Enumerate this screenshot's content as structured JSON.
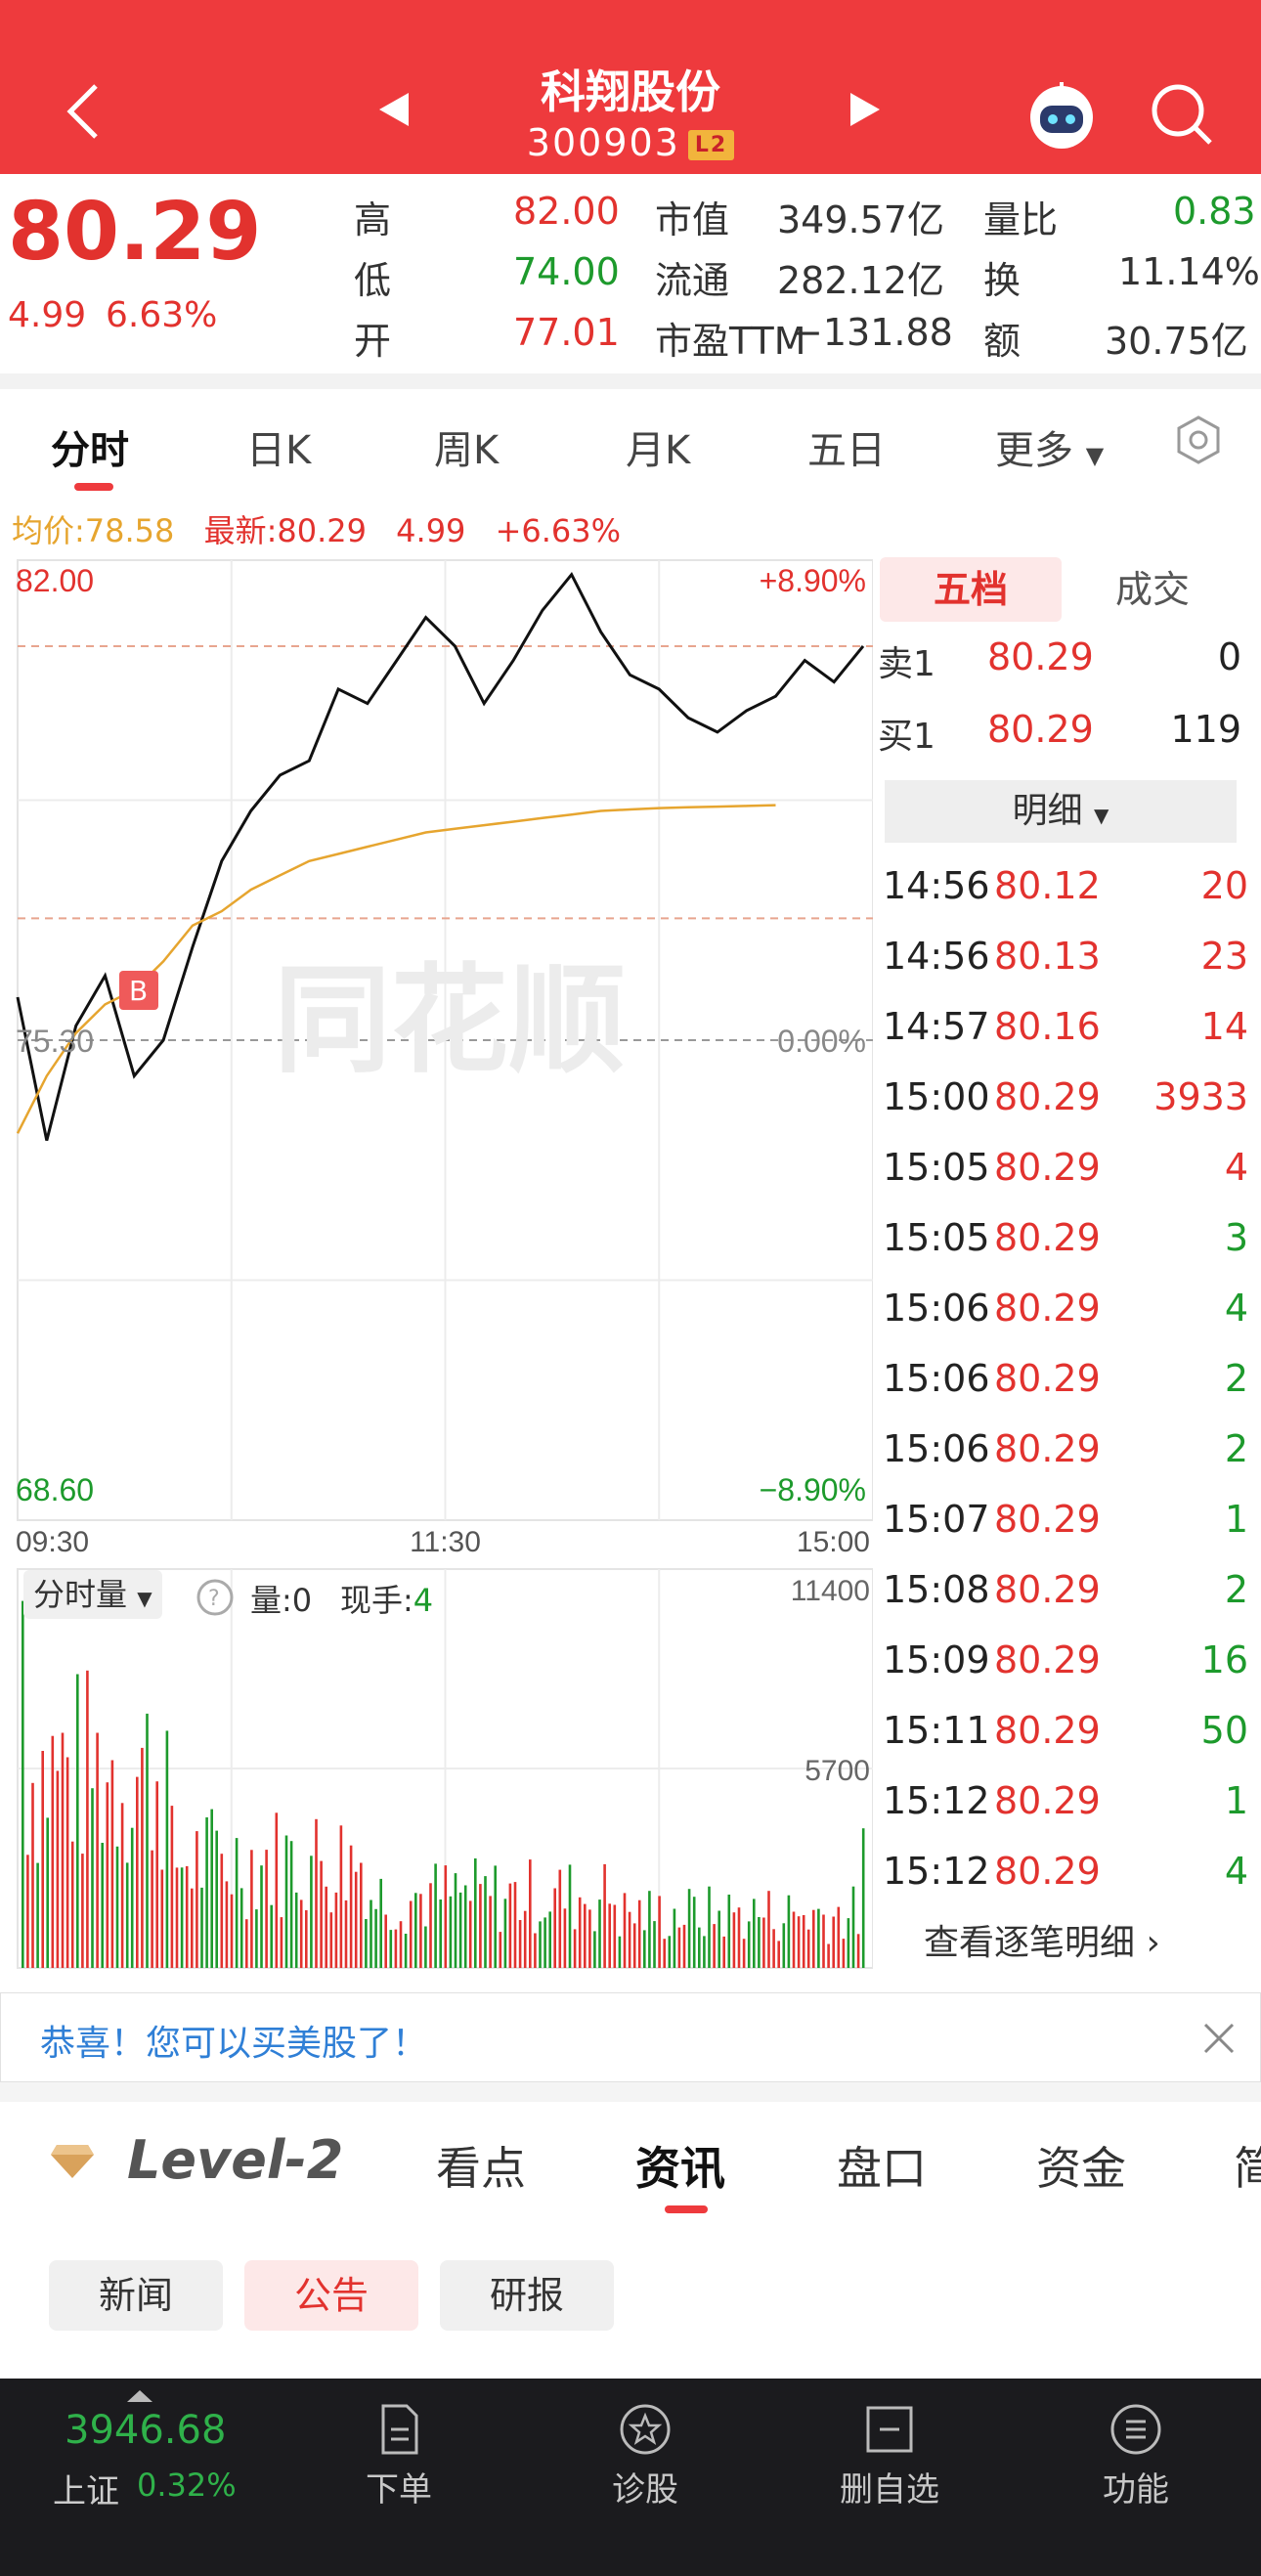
{
  "header": {
    "title": "科翔股份",
    "code": "300903",
    "badge": "L2"
  },
  "quote": {
    "price": "80.29",
    "change": "4.99",
    "change_pct": "6.63%",
    "high_label": "高",
    "high": "82.00",
    "low_label": "低",
    "low": "74.00",
    "open_label": "开",
    "open": "77.01",
    "mcap_label": "市值",
    "mcap": "349.57亿",
    "float_label": "流通",
    "float": "282.12亿",
    "pe_label": "市盈TTM",
    "pe": "−131.88",
    "vr_label": "量比",
    "vr": "0.83",
    "turn_label": "换",
    "turn": "11.14%",
    "amt_label": "额",
    "amt": "30.75亿"
  },
  "tabs": [
    "分时",
    "日K",
    "周K",
    "月K",
    "五日",
    "更多"
  ],
  "summary": {
    "avg": "均价:78.58",
    "latest": "最新:80.29",
    "chg": "4.99",
    "pct": "+6.63%"
  },
  "chart_data": {
    "type": "line",
    "title": "",
    "x_ticks": [
      "09:30",
      "11:30",
      "15:00"
    ],
    "y_left": [
      "82.00",
      "75.30",
      "68.60"
    ],
    "y_right": [
      "+8.90%",
      "0.00%",
      "−8.90%"
    ],
    "ylim": [
      68.6,
      82.0
    ],
    "prev_close": 75.3,
    "series": [
      {
        "name": "",
        "color": "#111111",
        "values": [
          75.9,
          73.9,
          75.5,
          76.2,
          74.8,
          75.3,
          76.6,
          77.8,
          78.5,
          79.0,
          79.2,
          80.2,
          80.0,
          80.6,
          81.2,
          80.8,
          80.0,
          80.6,
          81.3,
          81.8,
          81.0,
          80.4,
          80.2,
          79.8,
          79.6,
          79.9,
          80.1,
          80.6,
          80.3,
          80.8
        ]
      },
      {
        "name": "",
        "color": "#e6a52f",
        "values": [
          74.0,
          74.8,
          75.4,
          75.8,
          76.0,
          76.4,
          76.9,
          77.1,
          77.4,
          77.6,
          77.8,
          77.9,
          78.0,
          78.1,
          78.2,
          78.25,
          78.3,
          78.35,
          78.4,
          78.45,
          78.5,
          78.52,
          78.54,
          78.55,
          78.56,
          78.57,
          78.58
        ]
      }
    ],
    "marker": "B",
    "watermark": "同花顺"
  },
  "volume": {
    "label": "分时量",
    "q_label": "量:0",
    "hand_label": "现手:",
    "hand": "4",
    "max": "11400",
    "mid": "5700"
  },
  "orderbook": {
    "tabs": [
      "五档",
      "成交"
    ],
    "ask": {
      "label": "卖1",
      "price": "80.29",
      "vol": "0"
    },
    "bid": {
      "label": "买1",
      "price": "80.29",
      "vol": "119"
    },
    "detail_label": "明细",
    "ticks": [
      {
        "t": "14:56",
        "p": "80.12",
        "v": "20",
        "c": "red"
      },
      {
        "t": "14:56",
        "p": "80.13",
        "v": "23",
        "c": "red"
      },
      {
        "t": "14:57",
        "p": "80.16",
        "v": "14",
        "c": "red"
      },
      {
        "t": "15:00",
        "p": "80.29",
        "v": "3933",
        "c": "red"
      },
      {
        "t": "15:05",
        "p": "80.29",
        "v": "4",
        "c": "red"
      },
      {
        "t": "15:05",
        "p": "80.29",
        "v": "3",
        "c": "green"
      },
      {
        "t": "15:06",
        "p": "80.29",
        "v": "4",
        "c": "green"
      },
      {
        "t": "15:06",
        "p": "80.29",
        "v": "2",
        "c": "green"
      },
      {
        "t": "15:06",
        "p": "80.29",
        "v": "2",
        "c": "green"
      },
      {
        "t": "15:07",
        "p": "80.29",
        "v": "1",
        "c": "green"
      },
      {
        "t": "15:08",
        "p": "80.29",
        "v": "2",
        "c": "green"
      },
      {
        "t": "15:09",
        "p": "80.29",
        "v": "16",
        "c": "green"
      },
      {
        "t": "15:11",
        "p": "80.29",
        "v": "50",
        "c": "green"
      },
      {
        "t": "15:12",
        "p": "80.29",
        "v": "1",
        "c": "green"
      },
      {
        "t": "15:12",
        "p": "80.29",
        "v": "4",
        "c": "green"
      }
    ],
    "more": "查看逐笔明细 ›"
  },
  "banner": {
    "text": "恭喜！您可以买美股了！"
  },
  "news_tabs": {
    "level": "Level-2",
    "items": [
      "看点",
      "资讯",
      "盘口",
      "资金",
      "简"
    ],
    "active": "资讯"
  },
  "chips": [
    "新闻",
    "公告",
    "研报"
  ],
  "bottom": {
    "index_value": "3946.68",
    "index_name": "上证",
    "index_pct": "0.32%",
    "items": [
      "下单",
      "诊股",
      "删自选",
      "功能"
    ]
  },
  "colors": {
    "brand_red": "#ee3a3d",
    "up": "#e2322e",
    "down": "#1d9a2c",
    "avg": "#e6a52f"
  }
}
